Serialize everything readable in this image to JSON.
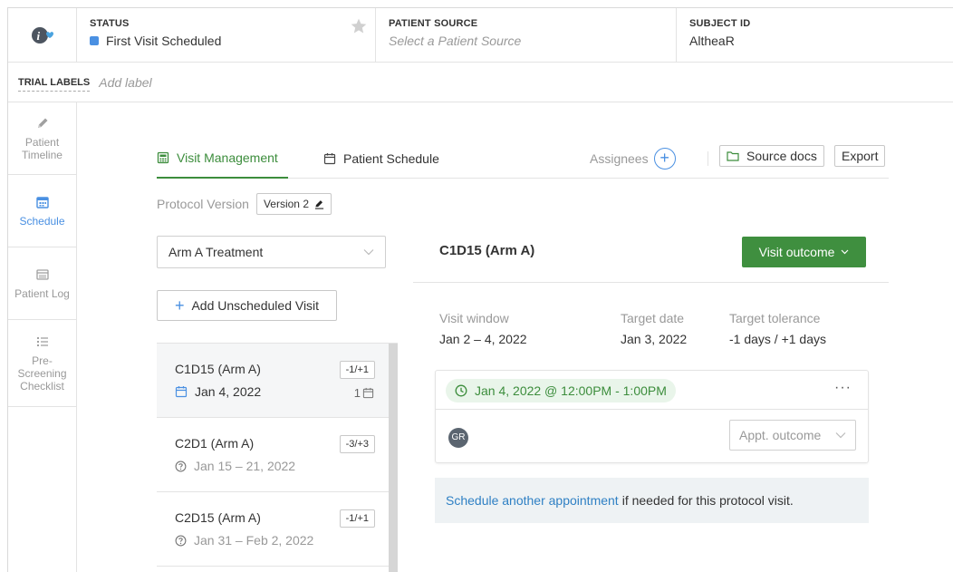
{
  "header": {
    "status_label": "STATUS",
    "status_value": "First Visit Scheduled",
    "status_color": "#4a90e2",
    "patient_source_label": "PATIENT SOURCE",
    "patient_source_placeholder": "Select a Patient Source",
    "subject_id_label": "SUBJECT ID",
    "subject_id_value": "AltheaR"
  },
  "trial_labels": {
    "label": "TRIAL LABELS",
    "placeholder": "Add label"
  },
  "sidebar": {
    "items": [
      {
        "label": "Patient Timeline",
        "icon": "pencil-icon"
      },
      {
        "label": "Schedule",
        "icon": "calendar-icon",
        "active": true
      },
      {
        "label": "Patient Log",
        "icon": "log-icon"
      },
      {
        "label": "Pre-Screening Checklist",
        "icon": "checklist-icon"
      }
    ]
  },
  "tabs": {
    "visit_management": "Visit Management",
    "patient_schedule": "Patient Schedule",
    "assignees": "Assignees",
    "source_docs": "Source docs",
    "export": "Export"
  },
  "protocol": {
    "label": "Protocol Version",
    "version": "Version 2"
  },
  "arm_select": {
    "value": "Arm A Treatment"
  },
  "add_visit_label": "Add Unscheduled Visit",
  "visits": [
    {
      "name": "C1D15 (Arm A)",
      "tolerance": "-1/+1",
      "date": "Jan 4, 2022",
      "count": "1",
      "selected": true
    },
    {
      "name": "C2D1 (Arm A)",
      "tolerance": "-3/+3",
      "date": "Jan 15 – 21, 2022"
    },
    {
      "name": "C2D15 (Arm A)",
      "tolerance": "-1/+1",
      "date": "Jan 31 – Feb 2, 2022"
    }
  ],
  "detail": {
    "title": "C1D15 (Arm A)",
    "outcome_button": "Visit outcome",
    "visit_window_label": "Visit window",
    "visit_window_value": "Jan 2 – 4, 2022",
    "target_date_label": "Target date",
    "target_date_value": "Jan 3, 2022",
    "target_tolerance_label": "Target tolerance",
    "target_tolerance_value": "-1 days / +1 days",
    "appointment_time": "Jan 4, 2022 @ 12:00PM - 1:00PM",
    "more_menu": "···",
    "assignee_initials": "GR",
    "appt_outcome_placeholder": "Appt. outcome",
    "schedule_link": "Schedule another appointment",
    "schedule_note": "if needed for this protocol visit."
  },
  "colors": {
    "accent_green": "#3c8d3c",
    "accent_blue": "#4a90e2",
    "link_blue": "#2f80c4"
  }
}
